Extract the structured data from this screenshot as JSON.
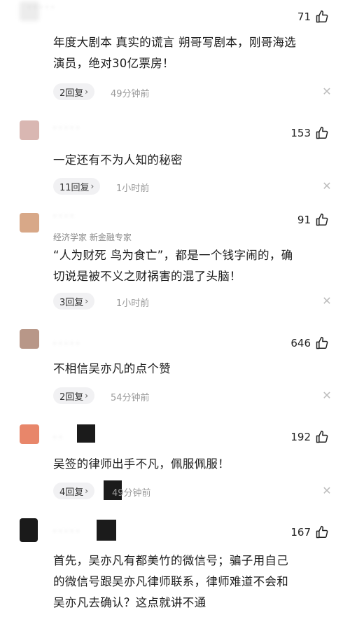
{
  "comments": [
    {
      "likes": "71",
      "text": [
        "年度大剧本 真实的谎言 朔哥写剧本，刚哥海选",
        "演员，绝对30亿票房！"
      ],
      "replies": "2回复",
      "time": "49分钟前",
      "avatar_color": "#e9e9e9"
    },
    {
      "likes": "153",
      "text": [
        "一定还有不为人知的秘密"
      ],
      "replies": "11回复",
      "time": "1小时前",
      "avatar_color": "#d9b7b2"
    },
    {
      "likes": "91",
      "tagline": "经济学家 新金融专家",
      "text": [
        "“人为财死 鸟为食亡”，都是一个钱字闹的，确",
        "切说是被不义之财祸害的混了头脑！"
      ],
      "replies": "3回复",
      "time": "1小时前",
      "avatar_color": "#d8a888"
    },
    {
      "likes": "646",
      "text": [
        "不相信吴亦凡的点个赞"
      ],
      "replies": "2回复",
      "time": "54分钟前",
      "avatar_color": "#b89788"
    },
    {
      "likes": "192",
      "text": [
        "吴签的律师出手不凡，佩服佩服！"
      ],
      "replies": "4回复",
      "time": "49分钟前",
      "avatar_color": "#e8866a"
    },
    {
      "likes": "167",
      "text": [
        "首先，吴亦凡有都美竹的微信号；骗子用自己",
        "的微信号跟吴亦凡律师联系，律师难道不会和",
        "吴亦凡去确认？这点就讲不通"
      ],
      "avatar_color": "#1a1a1a"
    }
  ],
  "icons": {
    "like": "thumb-up-icon",
    "close": "close-x-icon",
    "chevron": "chevron-right-icon"
  }
}
